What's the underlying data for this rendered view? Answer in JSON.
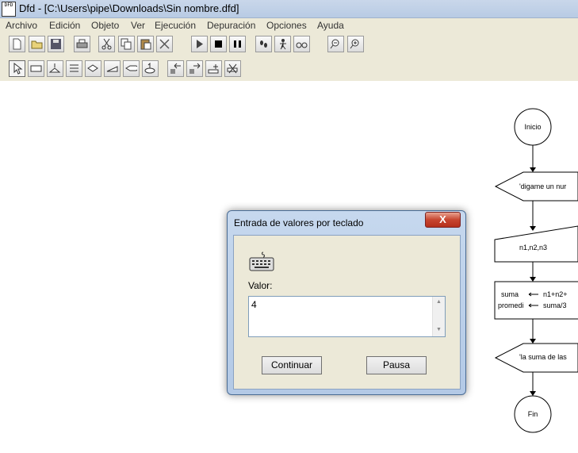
{
  "window": {
    "title": "Dfd - [C:\\Users\\pipe\\Downloads\\Sin nombre.dfd]",
    "app_icon_text": "DFD"
  },
  "menu": {
    "items": [
      "Archivo",
      "Edición",
      "Objeto",
      "Ver",
      "Ejecución",
      "Depuración",
      "Opciones",
      "Ayuda"
    ]
  },
  "toolbar": {
    "row1": [
      "new-icon",
      "open-icon",
      "save-icon",
      "print-icon",
      "cut-icon",
      "copy-icon",
      "paste-icon",
      "delete-icon",
      "run-icon",
      "stop-icon",
      "pause-icon",
      "step-icon",
      "debug-run-icon",
      "watch-icon",
      "zoom-out-icon",
      "zoom-in-icon"
    ],
    "row2": [
      "pointer-icon",
      "assignment-icon",
      "condition-icon",
      "loop-icon",
      "decision-icon",
      "read-icon",
      "write-icon",
      "subprogram-icon",
      "insert-left-icon",
      "insert-right-icon",
      "insert-param-icon",
      "remove-param-icon"
    ]
  },
  "flowchart": {
    "start": "Inicio",
    "output1": "'digame un nur",
    "input1": "n1,n2,n3",
    "assign_vars": [
      "suma",
      "promedi"
    ],
    "assign_values": [
      "n1+n2+",
      "suma/3"
    ],
    "output2": "'la suma de las",
    "end": "Fin"
  },
  "dialog": {
    "title": "Entrada de valores por teclado",
    "close_label": "X",
    "label": "Valor:",
    "value": "4",
    "continue_button": "Continuar",
    "pause_button": "Pausa"
  }
}
